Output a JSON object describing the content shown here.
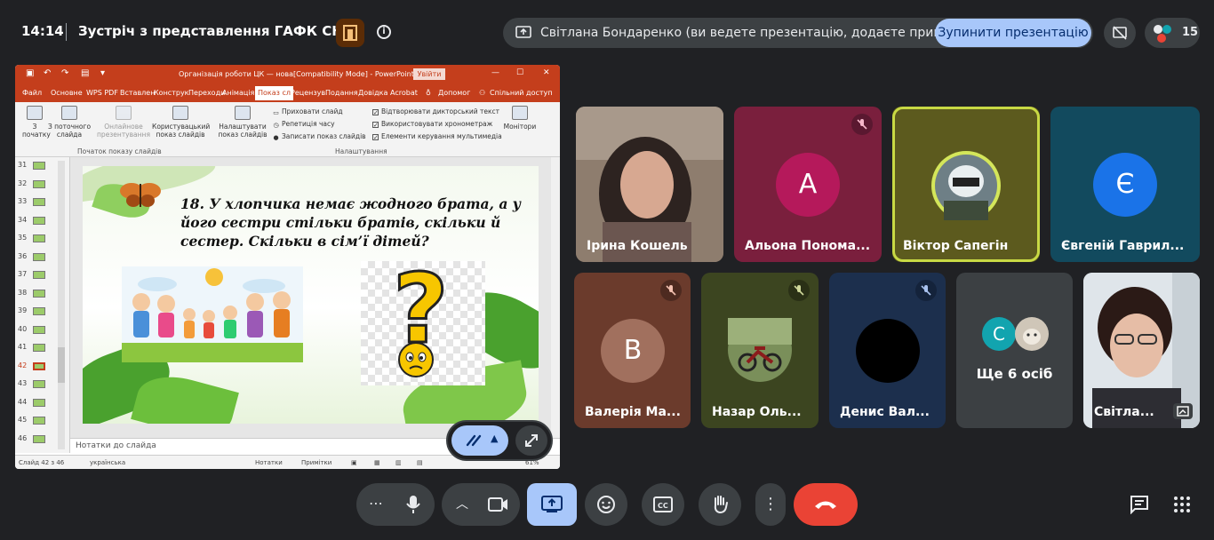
{
  "top": {
    "clock": "14:14",
    "meeting_title": "Зустріч з представлення ГАФК СНАУ",
    "presenter_text": "Світлана Бондаренко (ви ведете презентацію, додаєте примітки)",
    "stop_button": "Зупинити презентацію",
    "participant_count": "15"
  },
  "ppt": {
    "window_title": "Організація роботи ЦК — нова[Compatibility Mode] - PowerPoint",
    "login": "Увійти",
    "tabs": [
      "Файл",
      "Основне",
      "WPS PDF",
      "Вставлен",
      "Конструк",
      "Переходи",
      "Анімація",
      "Показ сл",
      "Рецензув",
      "Подання",
      "Довідка",
      "Acrobat",
      "Допомог",
      "Спільний доступ"
    ],
    "ribbon": {
      "from_start": "З початку",
      "from_current": "З поточного слайда",
      "online": "Онлайнове презентування",
      "custom": "Користувацький показ слайдів",
      "setup": "Налаштувати показ слайдів",
      "hide": "Приховати слайд",
      "rehearse": "Репетиція часу",
      "record": "Записати показ слайдів",
      "play_narration": "Відтворювати дикторський текст",
      "use_timings": "Використовувати хронометраж",
      "media_controls": "Елементи керування мультимедіа",
      "monitors": "Монітори",
      "group_start": "Початок показу слайдів",
      "group_settings": "Налаштування"
    },
    "thumbnails": [
      "31",
      "32",
      "33",
      "34",
      "35",
      "36",
      "37",
      "38",
      "39",
      "40",
      "41",
      "42",
      "43",
      "44",
      "45",
      "46"
    ],
    "current_slide": "42",
    "slide_question": "18. У хлопчика немає жодного брата, а у його сестри стільки братів, скільки й сестер. Скільки в сім’ї дітей?",
    "slide_symbol": "?",
    "notes_placeholder": "Нотатки до слайда",
    "status": {
      "slide_of": "Слайд 42 з 46",
      "language": "українська",
      "notes": "Нотатки",
      "comments": "Примітки",
      "zoom": "61%"
    }
  },
  "participants": [
    {
      "name": "Ірина Кошель",
      "muted": false
    },
    {
      "name": "Альона Пономa...",
      "letter": "А",
      "muted": true,
      "bg": "#7a1f3d",
      "avatar": "#b5195b"
    },
    {
      "name": "Віктор Сапегін",
      "muted": false,
      "bg": "#5c5a1e"
    },
    {
      "name": "Євгеній Гаврил...",
      "letter": "Є",
      "muted": false,
      "bg": "#124a5e",
      "avatar": "#1a73e8"
    },
    {
      "name": "Валерія Ма...",
      "letter": "В",
      "muted": true,
      "bg": "#6b3b2c",
      "avatar": "#a1705e"
    },
    {
      "name": "Назар Оль...",
      "muted": true,
      "bg": "#3c4520"
    },
    {
      "name": "Денис Вал...",
      "muted": true,
      "bg": "#1c2f4d"
    },
    {
      "name": "Ще 6 осіб",
      "letter": "С",
      "bg": "#3c4043",
      "avatar": "#12a4af"
    },
    {
      "name": "Світла...",
      "muted": false
    }
  ],
  "colors": {
    "accent": "#a8c7fa",
    "end_call": "#ea4335",
    "active_speaker": "#c8d944",
    "ppt_brand": "#c43e1c"
  }
}
